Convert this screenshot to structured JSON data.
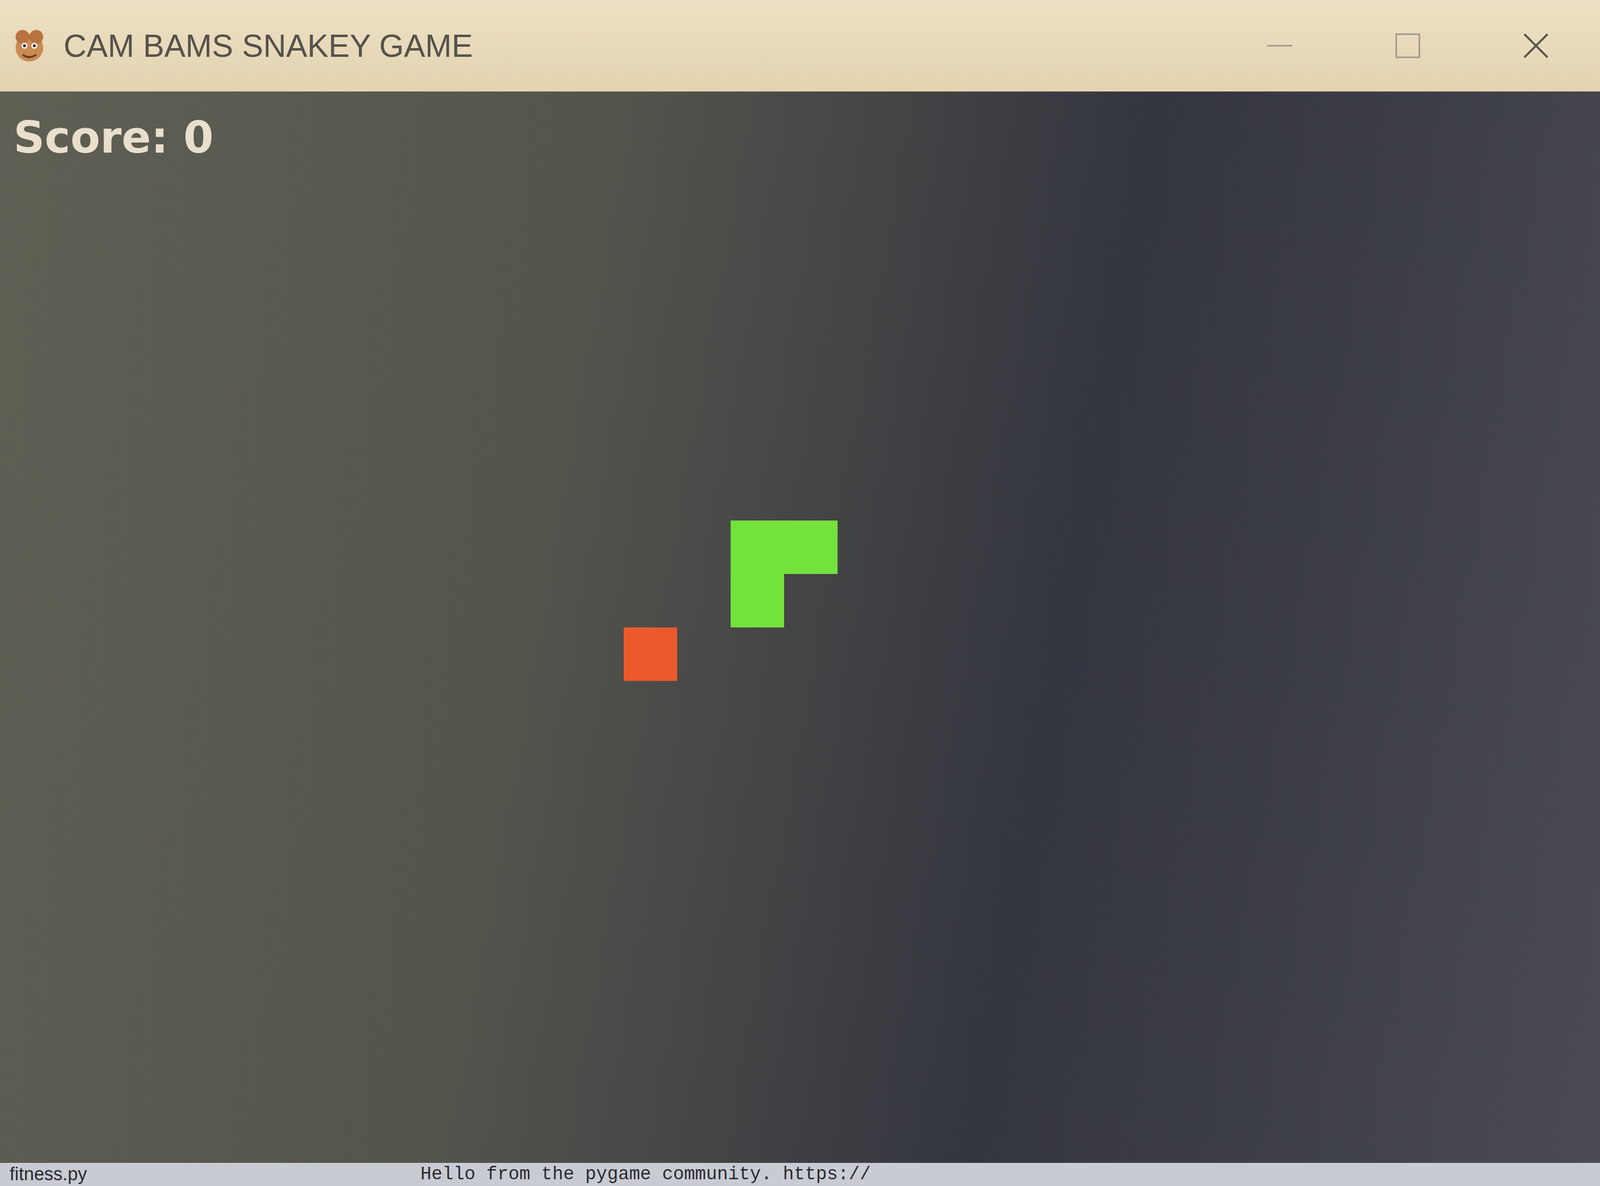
{
  "window": {
    "title": "CAM BAMS SNAKEY GAME"
  },
  "score": {
    "label": "Score: 0"
  },
  "snake": [
    {
      "col": 13,
      "row": 8
    },
    {
      "col": 14,
      "row": 8
    },
    {
      "col": 13,
      "row": 9
    }
  ],
  "food": {
    "col": 11,
    "row": 10
  },
  "taskbar": {
    "items": [
      "fitness.py",
      "Hello from the pygame community. https://"
    ]
  }
}
